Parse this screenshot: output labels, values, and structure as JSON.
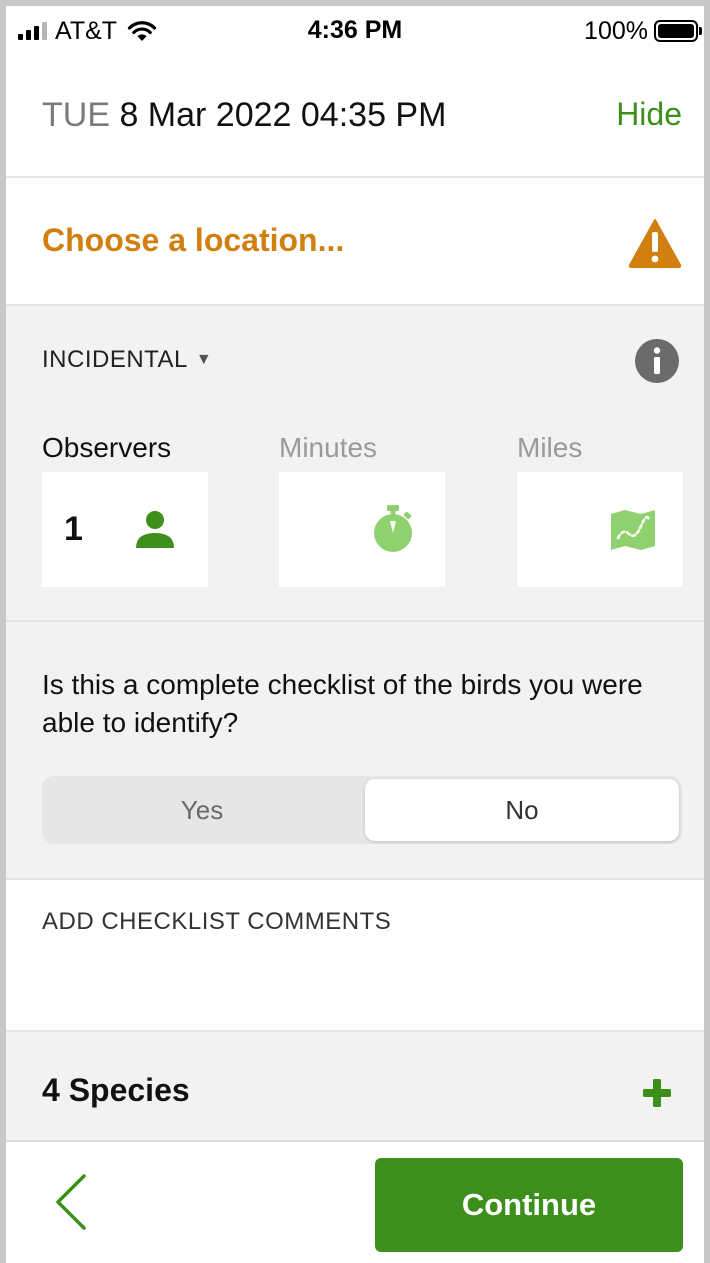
{
  "status_bar": {
    "carrier": "AT&T",
    "time": "4:36 PM",
    "battery": "100%"
  },
  "header": {
    "day_of_week": "TUE",
    "date_time": "8 Mar 2022 04:35 PM",
    "hide_label": "Hide"
  },
  "location": {
    "placeholder": "Choose a location...",
    "warning_icon": "warning-triangle-icon",
    "warning_color": "#d17f0f"
  },
  "effort": {
    "protocol": "INCIDENTAL",
    "observers_label": "Observers",
    "observers_value": "1",
    "minutes_label": "Minutes",
    "miles_label": "Miles"
  },
  "complete_checklist": {
    "question": "Is this a complete checklist of the birds you were able to identify?",
    "yes_label": "Yes",
    "no_label": "No",
    "selected": "No"
  },
  "comments": {
    "label": "ADD CHECKLIST COMMENTS"
  },
  "species": {
    "count_label": "4 Species"
  },
  "footer": {
    "continue_label": "Continue"
  },
  "colors": {
    "accent_green": "#3d8f1c",
    "light_green": "#8fd16f",
    "warning_orange": "#d17f0f"
  }
}
